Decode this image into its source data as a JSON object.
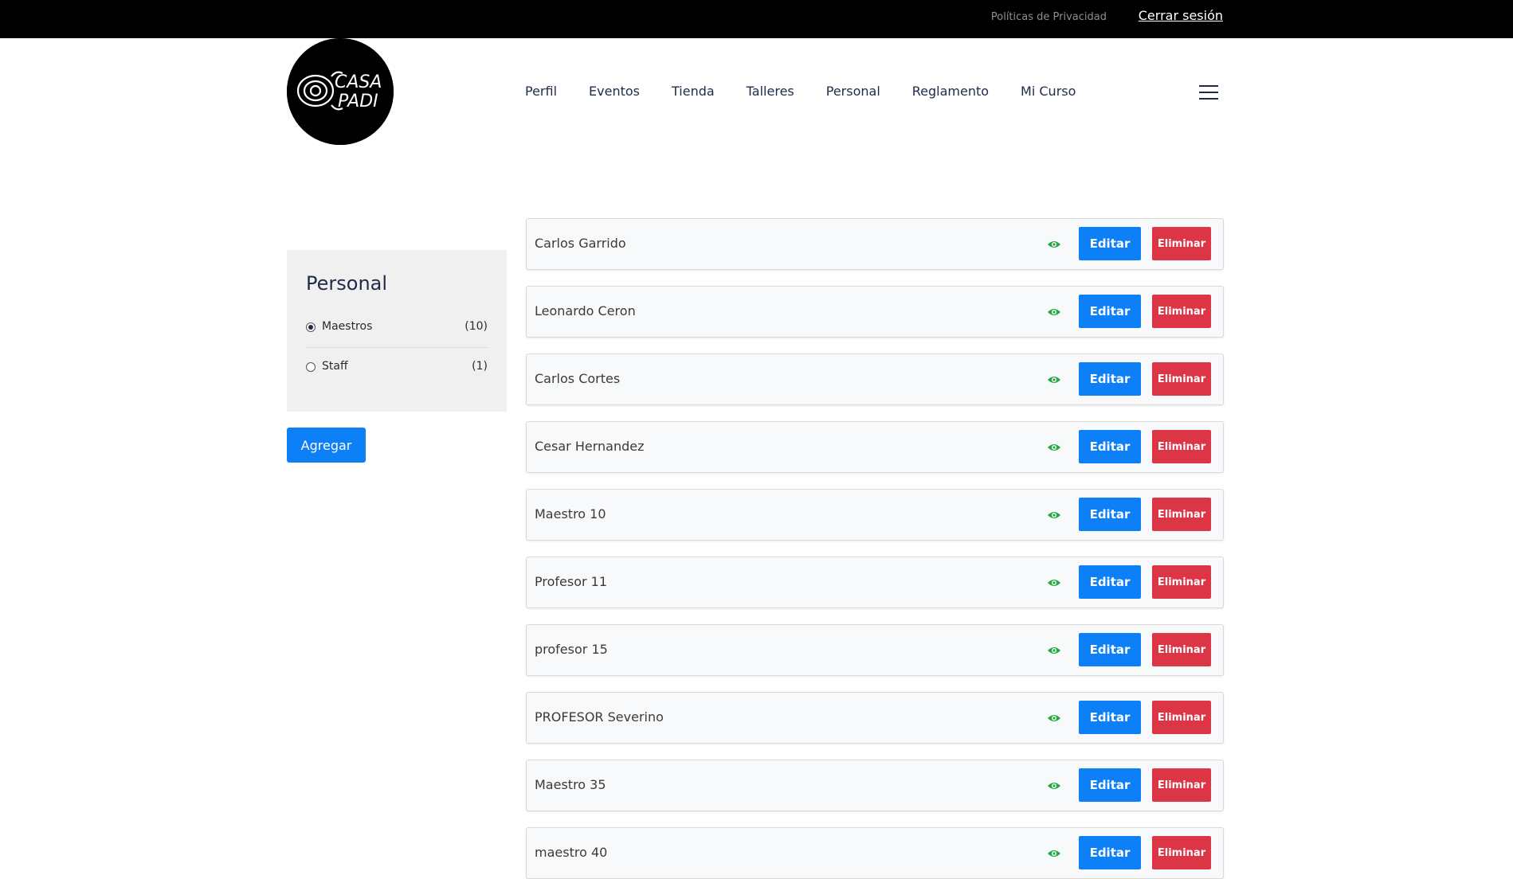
{
  "topbar": {
    "privacy_label": "Políticas de Privacidad",
    "logout_label": "Cerrar sesión"
  },
  "logo": {
    "icon": "casa-padi-logo",
    "line1": "CASA",
    "line2": "PADI"
  },
  "nav": {
    "items": [
      {
        "label": "Perfil"
      },
      {
        "label": "Eventos"
      },
      {
        "label": "Tienda"
      },
      {
        "label": "Talleres"
      },
      {
        "label": "Personal"
      },
      {
        "label": "Reglamento"
      },
      {
        "label": "Mi Curso"
      }
    ],
    "menu_icon": "hamburger-icon"
  },
  "sidebar": {
    "title": "Personal",
    "filters": [
      {
        "label": "Maestros",
        "count": "(10)",
        "selected": true
      },
      {
        "label": "Staff",
        "count": "(1)",
        "selected": false
      }
    ]
  },
  "add_button": "Agregar",
  "list": {
    "edit_label": "Editar",
    "delete_label": "Eliminar",
    "view_icon": "eye-icon",
    "items": [
      {
        "name": "Carlos Garrido"
      },
      {
        "name": "Leonardo Ceron"
      },
      {
        "name": "Carlos Cortes"
      },
      {
        "name": "Cesar Hernandez"
      },
      {
        "name": "Maestro 10"
      },
      {
        "name": "Profesor 11"
      },
      {
        "name": "profesor 15"
      },
      {
        "name": "PROFESOR Severino"
      },
      {
        "name": "Maestro 35"
      },
      {
        "name": "maestro 40"
      }
    ]
  },
  "colors": {
    "primary": "#0d7ff7",
    "danger": "#dc3545",
    "eye": "#28a745",
    "nav_text": "#1f2a4a",
    "topbar": "#000000"
  }
}
